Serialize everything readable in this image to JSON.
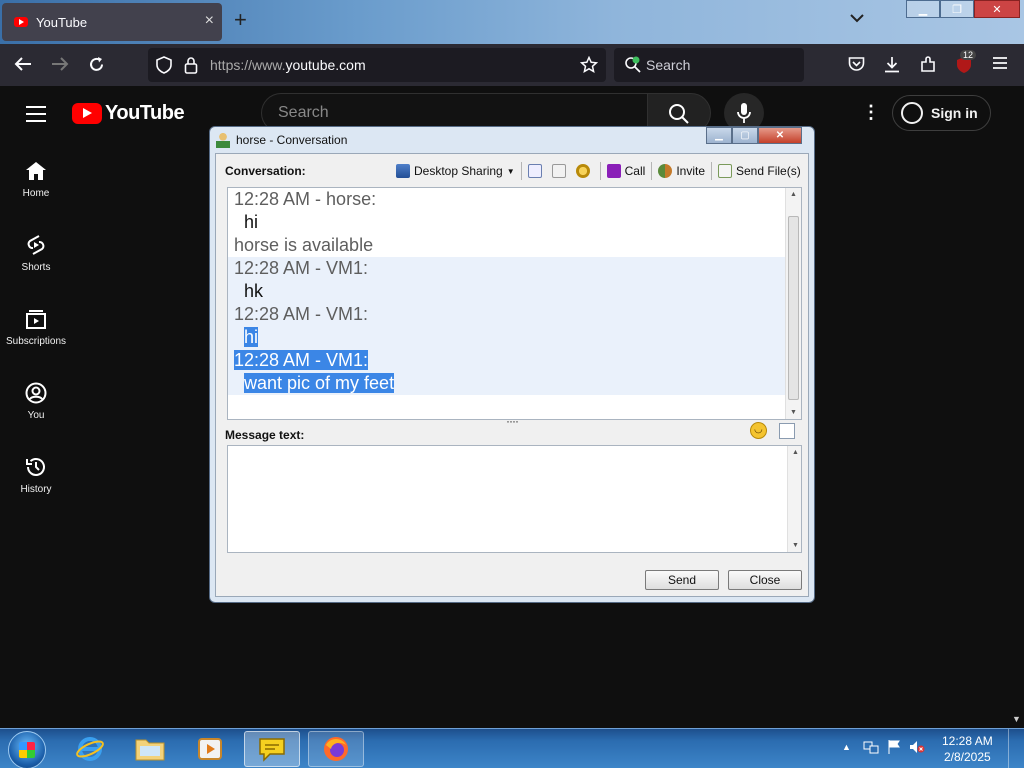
{
  "browser": {
    "tab_title": "YouTube",
    "tab_close": "×",
    "new_tab": "+",
    "url_prefix": "https://www.",
    "url_domain": "youtube.com",
    "search_placeholder": "Search",
    "extensions_badge": "12"
  },
  "youtube": {
    "logo_text": "YouTube",
    "search_placeholder": "Search",
    "sign_in": "Sign in",
    "sidebar": [
      {
        "label": "Home",
        "icon": "home-icon"
      },
      {
        "label": "Shorts",
        "icon": "shorts-icon"
      },
      {
        "label": "Subscriptions",
        "icon": "subscriptions-icon"
      },
      {
        "label": "You",
        "icon": "you-icon"
      },
      {
        "label": "History",
        "icon": "history-icon"
      }
    ]
  },
  "dialog": {
    "title": "horse - Conversation",
    "conversation_label": "Conversation:",
    "tools": {
      "desktop_sharing": "Desktop Sharing",
      "call": "Call",
      "invite": "Invite",
      "send_files": "Send File(s)"
    },
    "log": [
      {
        "text": "12:28 AM - horse:",
        "kind": "hdr"
      },
      {
        "text": "hi",
        "kind": "msg"
      },
      {
        "text": "horse is available",
        "kind": "hdr"
      },
      {
        "text": "12:28 AM - VM1:",
        "kind": "hdr"
      },
      {
        "text": "hk",
        "kind": "msg"
      },
      {
        "text": "12:28 AM - VM1:",
        "kind": "hdr"
      },
      {
        "text": "hi",
        "kind": "msg"
      },
      {
        "text": "12:28 AM - VM1:",
        "kind": "hdr"
      },
      {
        "text": "want pic of my feet",
        "kind": "msg"
      }
    ],
    "message_label": "Message text:",
    "message_value": "",
    "send_button": "Send",
    "close_button": "Close"
  },
  "taskbar": {
    "time": "12:28 AM",
    "date": "2/8/2025"
  }
}
